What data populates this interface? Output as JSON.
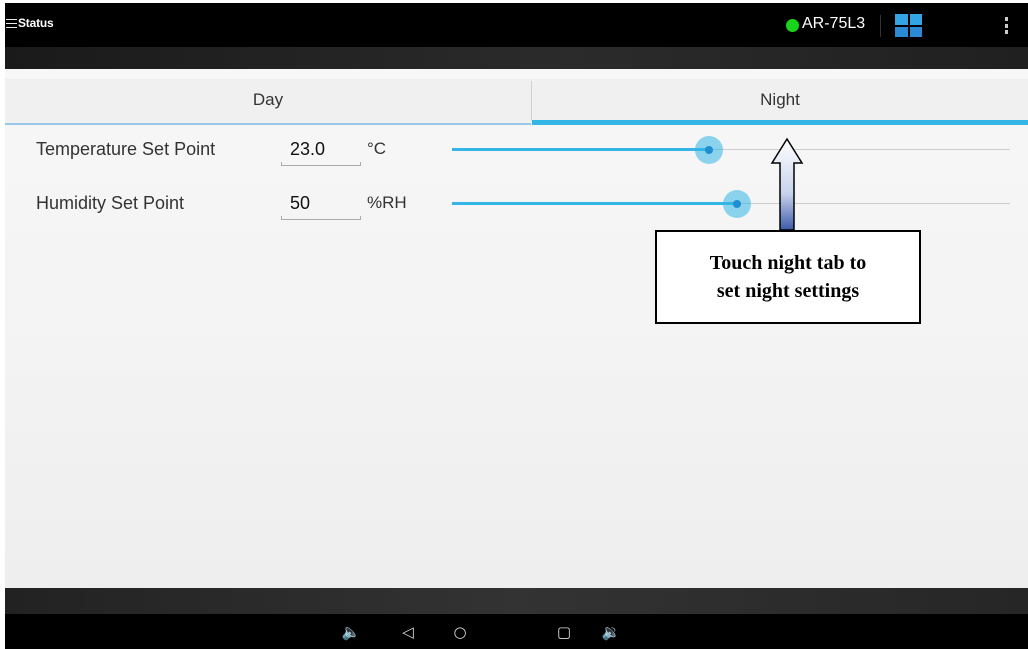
{
  "actionbar": {
    "title": "Status",
    "device_name": "AR-75L3",
    "status_color": "#19d519",
    "icons": [
      "menu-icon",
      "dashboard-grid-icon",
      "overflow-menu-icon"
    ]
  },
  "tabs": [
    {
      "label": "Day",
      "selected": false
    },
    {
      "label": "Night",
      "selected": true
    }
  ],
  "settings": {
    "temperature": {
      "label": "Temperature Set Point",
      "value": "23.0",
      "unit": "°C",
      "slider_fraction": 0.46
    },
    "humidity": {
      "label": "Humidity Set Point",
      "value": "50",
      "unit": "%RH",
      "slider_fraction": 0.51
    }
  },
  "callout": {
    "text": "Touch night tab to\nset night settings"
  },
  "navbar": {
    "volume_down": "🔈",
    "back": "◁",
    "home": "○",
    "recents": "▢",
    "volume_up": "🔉"
  },
  "colors": {
    "accent": "#33b5e5",
    "background": "#f3f3f3"
  }
}
